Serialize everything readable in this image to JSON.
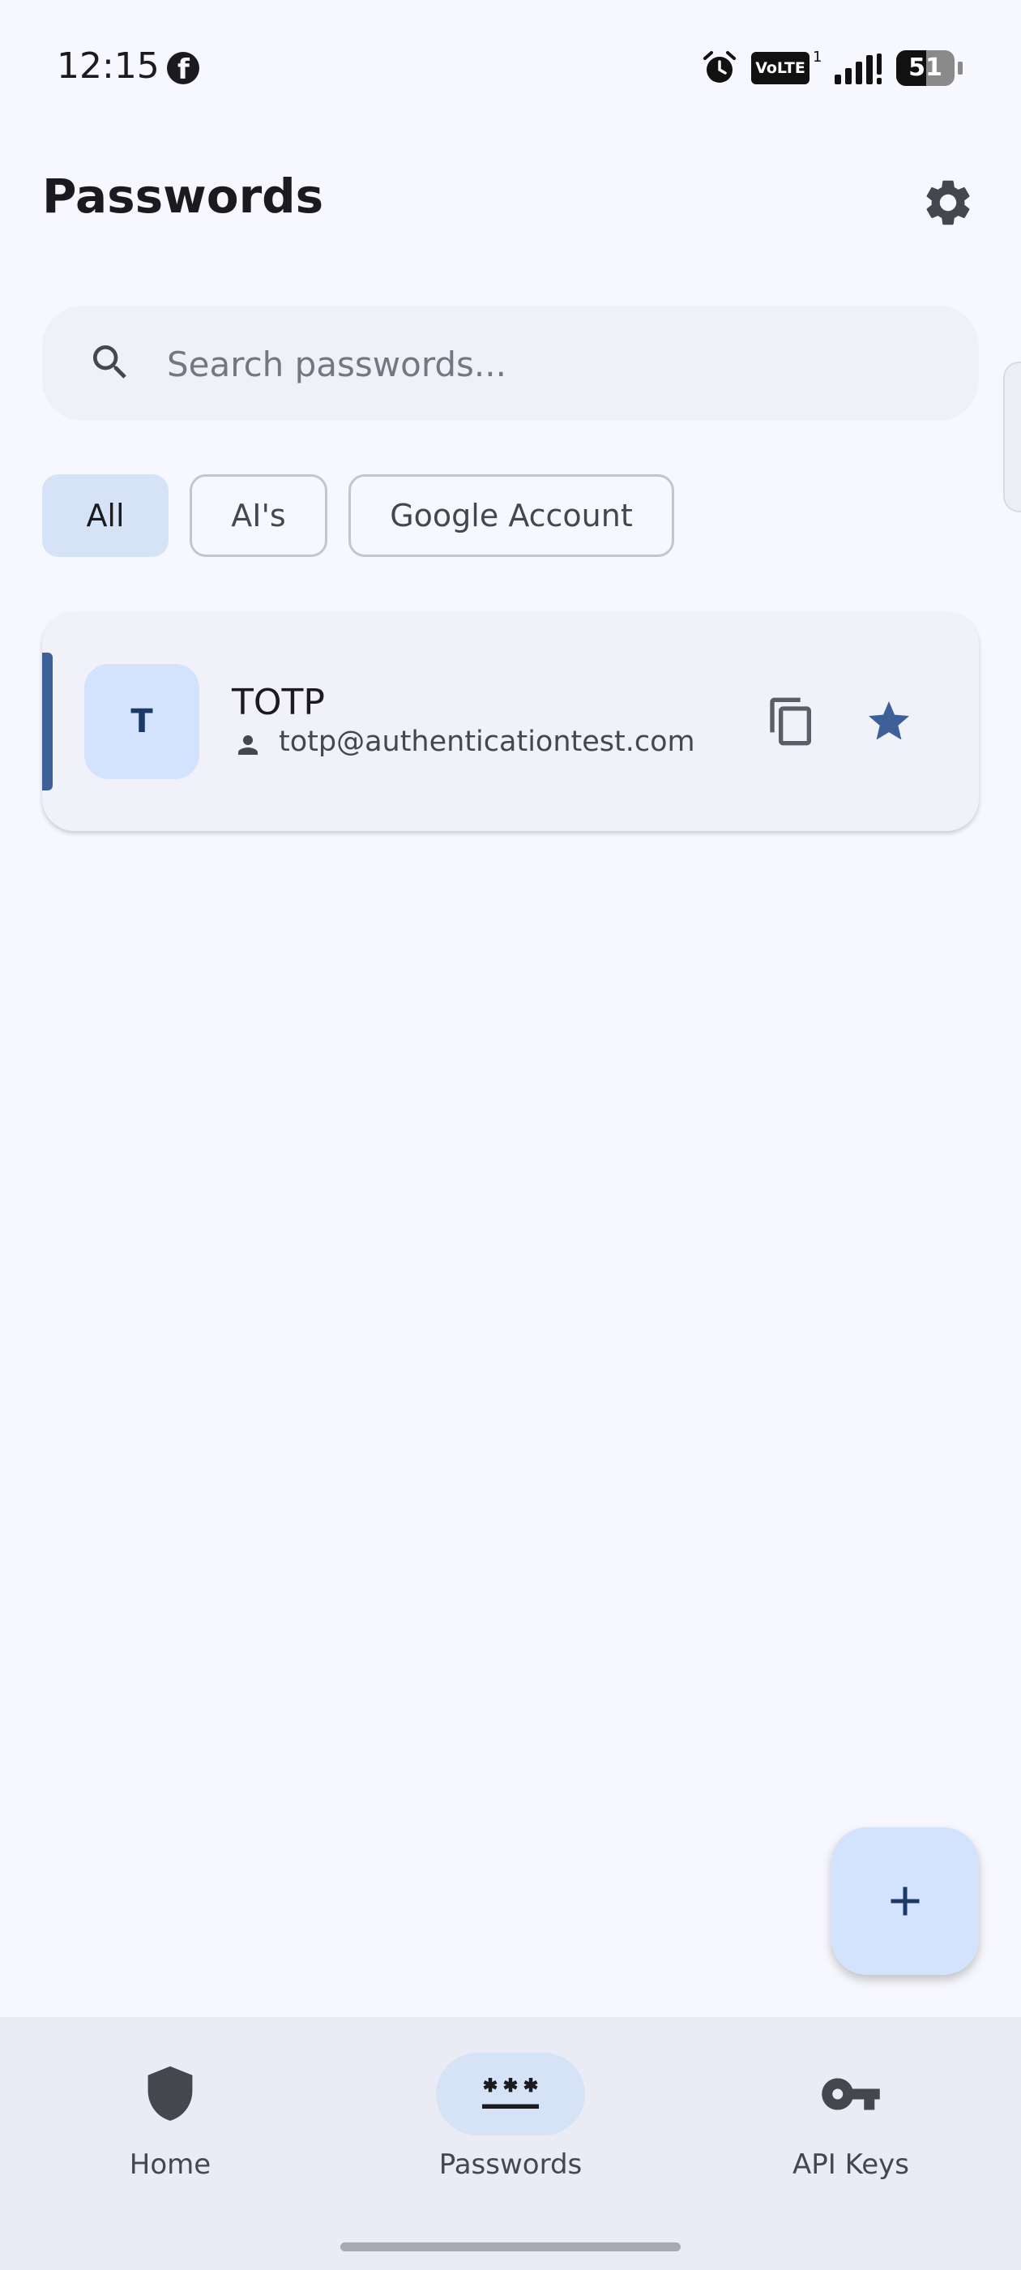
{
  "status_bar": {
    "time": "12:15",
    "network_badge": "VoLTE",
    "network_sup": "1",
    "battery_percent": 51,
    "battery_label": "51"
  },
  "header": {
    "title": "Passwords"
  },
  "search": {
    "placeholder": "Search passwords...",
    "value": ""
  },
  "filters": [
    {
      "label": "All",
      "selected": true
    },
    {
      "label": "AI's",
      "selected": false
    },
    {
      "label": "Google Account",
      "selected": false
    }
  ],
  "entries": [
    {
      "avatar_letter": "T",
      "title": "TOTP",
      "username": "totp@authenticationtest.com",
      "favorite": true
    }
  ],
  "bottom_nav": [
    {
      "label": "Home",
      "icon": "shield-icon",
      "active": false
    },
    {
      "label": "Passwords",
      "icon": "password-icon",
      "active": true
    },
    {
      "label": "API Keys",
      "icon": "key-icon",
      "active": false
    }
  ],
  "colors": {
    "accent": "#3e6098",
    "background": "#f7f8fd",
    "chip_selected": "#d6e3f7",
    "fab": "#d3e3fd"
  }
}
